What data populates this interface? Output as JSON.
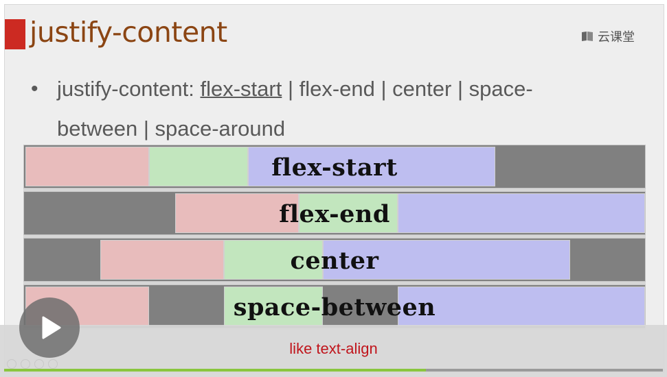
{
  "slide": {
    "title": "justify-content",
    "brand_name": "云课堂",
    "bullet": {
      "prefix": "justify-content: ",
      "underlined": "flex-start",
      "rest_line1": " | flex-end | center | space-",
      "rest_line2": "between | space-around"
    }
  },
  "demo": {
    "rows": [
      {
        "label": "flex-start"
      },
      {
        "label": "flex-end"
      },
      {
        "label": "center"
      },
      {
        "label": "space-between"
      }
    ],
    "colors": {
      "container": "#808080",
      "item1": "#e8bcbc",
      "item2": "#c2e6be",
      "item3": "#bebef0"
    }
  },
  "player": {
    "subtitle": "like text-align",
    "progress_fraction": 0.64,
    "play_icon": "play-icon"
  }
}
